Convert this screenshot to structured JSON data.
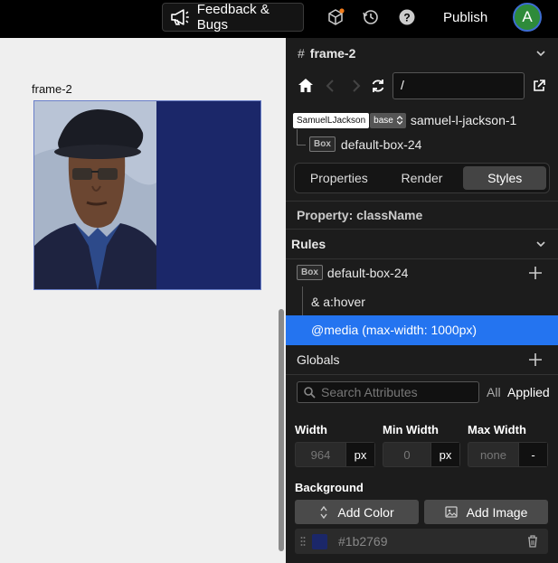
{
  "topbar": {
    "feedback_label": "Feedback & Bugs",
    "publish_label": "Publish",
    "avatar_initial": "A"
  },
  "canvas": {
    "frame_label": "frame-2"
  },
  "panel": {
    "title": "frame-2",
    "url_value": "/",
    "component_tag": "SamuelLJackson",
    "base_tag": "base",
    "component_name": "samuel-l-jackson-1",
    "box_tag": "Box",
    "box_name": "default-box-24",
    "tabs": [
      {
        "label": "Properties"
      },
      {
        "label": "Render"
      },
      {
        "label": "Styles"
      }
    ],
    "property_label": "Property: className",
    "rules_label": "Rules",
    "rule_box_tag": "Box",
    "rule_box_name": "default-box-24",
    "rule_hover": "& a:hover",
    "rule_media": "@media (max-width: 1000px)",
    "globals_label": "Globals",
    "search_placeholder": "Search Attributes",
    "filter_all": "All",
    "filter_applied": "Applied",
    "width": {
      "label": "Width",
      "value": "964",
      "unit": "px"
    },
    "min_width": {
      "label": "Min Width",
      "value": "0",
      "unit": "px"
    },
    "max_width": {
      "label": "Max Width",
      "value": "none",
      "unit": "-"
    },
    "background_label": "Background",
    "add_color_label": "Add Color",
    "add_image_label": "Add Image",
    "bg_color": "#1b2769"
  }
}
